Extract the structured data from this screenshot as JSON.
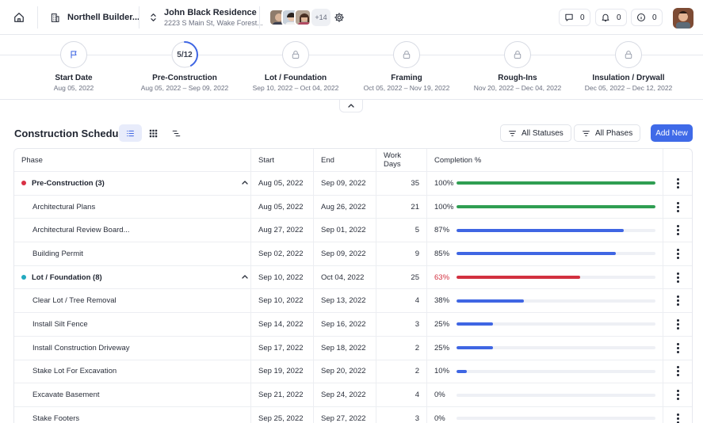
{
  "topbar": {
    "company": "Northell Builder...",
    "project_title": "John Black Residence",
    "project_address": "2223 S Main St, Wake Forest...",
    "avatars_more": "+14",
    "comments_count": "0",
    "notifications_count": "0",
    "info_count": "0"
  },
  "timeline": [
    {
      "title": "Start Date",
      "dates": "Aug 05, 2022",
      "icon": "flag-icon",
      "state": "done"
    },
    {
      "title": "Pre-Construction",
      "dates": "Aug 05, 2022 – Sep 09, 2022",
      "icon": "progress",
      "progress_label": "5/12",
      "progress": 0.4167
    },
    {
      "title": "Lot / Foundation",
      "dates": "Sep 10, 2022 – Oct 04, 2022",
      "icon": "lock-icon",
      "state": "locked"
    },
    {
      "title": "Framing",
      "dates": "Oct 05, 2022 – Nov 19, 2022",
      "icon": "lock-icon",
      "state": "locked"
    },
    {
      "title": "Rough-Ins",
      "dates": "Nov 20, 2022 – Dec 04, 2022",
      "icon": "lock-icon",
      "state": "locked"
    },
    {
      "title": "Insulation / Drywall",
      "dates": "Dec 05, 2022 – Dec 12, 2022",
      "icon": "lock-icon",
      "state": "locked"
    }
  ],
  "section": {
    "title": "Construction Schedule",
    "filter_statuses": "All Statuses",
    "filter_phases": "All Phases",
    "add_label": "Add New"
  },
  "table": {
    "headers": {
      "phase": "Phase",
      "start": "Start",
      "end": "End",
      "days": "Work Days",
      "completion": "Completion %"
    },
    "rows": [
      {
        "type": "group",
        "name": "Pre-Construction (3)",
        "dot": "#d93044",
        "start": "Aug 05, 2022",
        "end": "Sep 09, 2022",
        "days": "35",
        "pct": "100%",
        "value": 1.0,
        "bar": "#2f9e52",
        "pct_color": "#2a2f3b"
      },
      {
        "type": "child",
        "name": "Architectural Plans",
        "start": "Aug 05, 2022",
        "end": "Aug 26, 2022",
        "days": "21",
        "pct": "100%",
        "value": 1.0,
        "bar": "#2f9e52",
        "pct_color": "#2a2f3b"
      },
      {
        "type": "child",
        "name": "Architectural Review Board...",
        "start": "Aug 27, 2022",
        "end": "Sep 01, 2022",
        "days": "5",
        "pct": "87%",
        "value": 0.84,
        "bar": "#3f66e3",
        "pct_color": "#2a2f3b"
      },
      {
        "type": "child",
        "name": "Building Permit",
        "start": "Sep 02, 2022",
        "end": "Sep 09, 2022",
        "days": "9",
        "pct": "85%",
        "value": 0.8,
        "bar": "#3f66e3",
        "pct_color": "#2a2f3b"
      },
      {
        "type": "group",
        "name": "Lot / Foundation (8)",
        "dot": "#22a9bf",
        "start": "Sep 10, 2022",
        "end": "Oct 04, 2022",
        "days": "25",
        "pct": "63%",
        "value": 0.62,
        "bar": "#d2303f",
        "pct_color": "#d2303f"
      },
      {
        "type": "child",
        "name": "Clear Lot / Tree Removal",
        "start": "Sep 10, 2022",
        "end": "Sep 13, 2022",
        "days": "4",
        "pct": "38%",
        "value": 0.34,
        "bar": "#3f66e3",
        "pct_color": "#2a2f3b"
      },
      {
        "type": "child",
        "name": "Install Silt Fence",
        "start": "Sep 14, 2022",
        "end": "Sep 16, 2022",
        "days": "3",
        "pct": "25%",
        "value": 0.185,
        "bar": "#3f66e3",
        "pct_color": "#2a2f3b"
      },
      {
        "type": "child",
        "name": "Install Construction Driveway",
        "start": "Sep 17, 2022",
        "end": "Sep 18, 2022",
        "days": "2",
        "pct": "25%",
        "value": 0.185,
        "bar": "#3f66e3",
        "pct_color": "#2a2f3b"
      },
      {
        "type": "child",
        "name": "Stake Lot For Excavation",
        "start": "Sep 19, 2022",
        "end": "Sep 20, 2022",
        "days": "2",
        "pct": "10%",
        "value": 0.05,
        "bar": "#3f66e3",
        "pct_color": "#2a2f3b"
      },
      {
        "type": "child",
        "name": "Excavate Basement",
        "start": "Sep 21, 2022",
        "end": "Sep 24, 2022",
        "days": "4",
        "pct": "0%",
        "value": 0,
        "bar": "#3f66e3",
        "pct_color": "#2a2f3b"
      },
      {
        "type": "child",
        "name": "Stake Footers",
        "start": "Sep 25, 2022",
        "end": "Sep 27, 2022",
        "days": "3",
        "pct": "0%",
        "value": 0,
        "bar": "#3f66e3",
        "pct_color": "#2a2f3b"
      }
    ]
  }
}
